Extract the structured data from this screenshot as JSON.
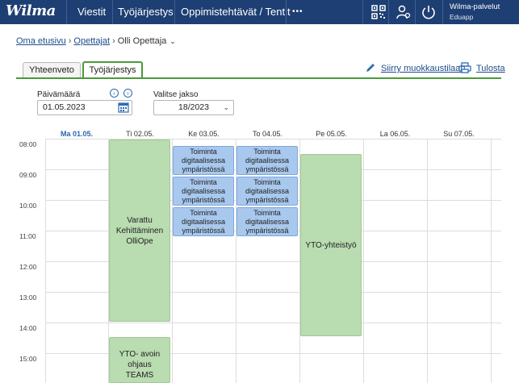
{
  "topbar": {
    "logo": "Wilma",
    "nav": [
      "Viestit",
      "Työjärjestys",
      "Oppimistehtävät / Tentit",
      "•••"
    ],
    "icons": [
      "qr-code-icon",
      "user-settings-icon",
      "power-icon"
    ],
    "user": {
      "title": "Wilma-palvelut",
      "org": "Eduapp"
    },
    "bg_color": "#1e3f73"
  },
  "breadcrumb": {
    "home": "Oma etusivu",
    "teachers": "Opettajat",
    "current": "Olli Opettaja"
  },
  "tabs": {
    "overview": "Yhteenveto",
    "schedule": "Työjärjestys",
    "edit_link": "Siirry muokkaustilaan",
    "print_link": "Tulosta"
  },
  "form": {
    "date_label": "Päivämäärä",
    "date_value": "01.05.2023",
    "period_label": "Valitse jakso",
    "period_value": "18/2023"
  },
  "calendar": {
    "days": [
      "Ma 01.05.",
      "Ti 02.05.",
      "Ke 03.05.",
      "To 04.05.",
      "Pe 05.05.",
      "La 06.05.",
      "Su 07.05."
    ],
    "hours": [
      "08:00",
      "09:00",
      "10:00",
      "11:00",
      "12:00",
      "13:00",
      "14:00",
      "15:00"
    ],
    "events": [
      {
        "text": "Varattu Kehittäminen OlliOpe",
        "color": "green"
      },
      {
        "text": "YTO- avoin ohjaus TEAMS",
        "color": "green"
      },
      {
        "text": "Toiminta digitaalisessa ympäristössä",
        "color": "blue"
      },
      {
        "text": "Toiminta digitaalisessa ympäristössä",
        "color": "blue"
      },
      {
        "text": "Toiminta digitaalisessa ympäristössä",
        "color": "blue"
      },
      {
        "text": "Toiminta digitaalisessa ympäristössä",
        "color": "blue"
      },
      {
        "text": "Toiminta digitaalisessa ympäristössä",
        "color": "blue"
      },
      {
        "text": "Toiminta digitaalisessa ympäristössä",
        "color": "blue"
      },
      {
        "text": "YTO-yhteistyö",
        "color": "green"
      }
    ]
  }
}
